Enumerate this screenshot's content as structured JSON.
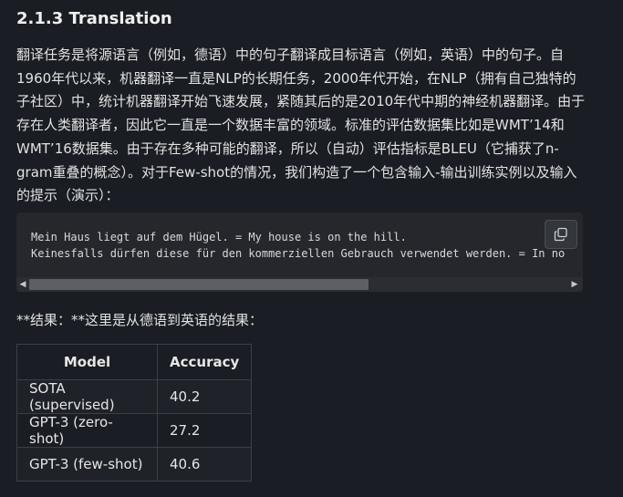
{
  "section": {
    "heading": "2.1.3 Translation",
    "paragraph": "翻译任务是将源语言（例如，德语）中的句子翻译成目标语言（例如，英语）中的句子。自1960年代以来，机器翻译一直是NLP的长期任务，2000年代开始，在NLP（拥有自己独特的子社区）中，统计机器翻译开始飞速发展，紧随其后的是2010年代中期的神经机器翻译。由于存在人类翻译者，因此它一直是一个数据丰富的领域。标准的评估数据集比如是WMT’14和WMT’16数据集。由于存在多种可能的翻译，所以（自动）评估指标是BLEU（它捕获了n-gram重叠的概念）。对于Few-shot的情况，我们构造了一个包含输入-输出训练实例以及输入的提示（演示）："
  },
  "code": {
    "line1": "Mein Haus liegt auf dem Hügel. = My house is on the hill.",
    "line2": "Keinesfalls dürfen diese für den kommerziellen Gebrauch verwendet werden. = In no"
  },
  "result_text": "**结果：**这里是从德语到英语的结果：",
  "table": {
    "headers": [
      "Model",
      "Accuracy"
    ],
    "rows": [
      {
        "model": "SOTA (supervised)",
        "accuracy": "40.2"
      },
      {
        "model": "GPT-3 (zero-shot)",
        "accuracy": "27.2"
      },
      {
        "model": "GPT-3 (few-shot)",
        "accuracy": "40.6"
      }
    ]
  },
  "icons": {
    "copy": "copy-icon",
    "scroll_left": "scroll-left-arrow-icon",
    "scroll_right": "scroll-right-arrow-icon"
  }
}
